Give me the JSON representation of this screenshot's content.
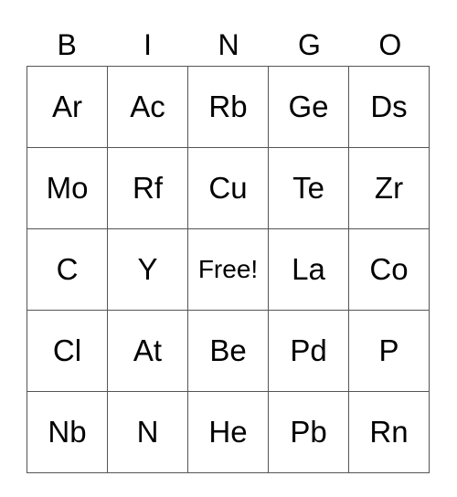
{
  "header": [
    "B",
    "I",
    "N",
    "G",
    "O"
  ],
  "rows": [
    [
      "Ar",
      "Ac",
      "Rb",
      "Ge",
      "Ds"
    ],
    [
      "Mo",
      "Rf",
      "Cu",
      "Te",
      "Zr"
    ],
    [
      "C",
      "Y",
      "Free!",
      "La",
      "Co"
    ],
    [
      "Cl",
      "At",
      "Be",
      "Pd",
      "P"
    ],
    [
      "Nb",
      "N",
      "He",
      "Pb",
      "Rn"
    ]
  ]
}
